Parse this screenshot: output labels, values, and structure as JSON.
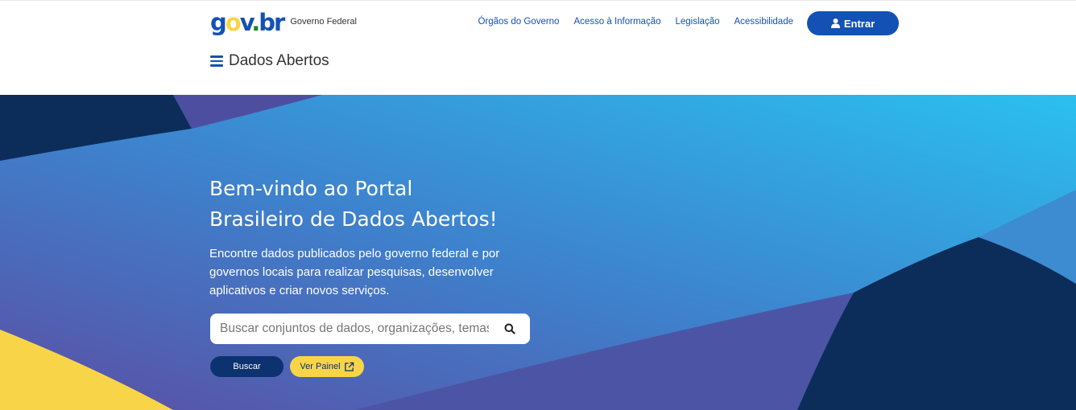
{
  "header": {
    "logo": {
      "g": "g",
      "o": "o",
      "v": "v",
      "dot": ".",
      "br": "br"
    },
    "logo_subtitle": "Governo Federal",
    "nav": [
      {
        "label": "Órgãos do Governo"
      },
      {
        "label": "Acesso à Informação"
      },
      {
        "label": "Legislação"
      },
      {
        "label": "Acessibilidade"
      }
    ],
    "login_label": "Entrar",
    "menu_title": "Dados Abertos"
  },
  "hero": {
    "title_line1": "Bem-vindo ao Portal",
    "title_line2": "Brasileiro de Dados Abertos!",
    "description": "Encontre dados publicados pelo governo federal e por governos locais para realizar pesquisas, desenvolver aplicativos e criar novos serviços.",
    "search_placeholder": "Buscar conjuntos de dados, organizações, temas",
    "search_button": "Buscar",
    "panel_button": "Ver Painel"
  },
  "colors": {
    "primary_blue": "#1351b4",
    "dark_navy": "#0c326f",
    "yellow": "#f8d548",
    "green": "#168821",
    "purple": "#5a4fa3",
    "sky": "#2bbcef"
  },
  "icons": [
    "user-icon",
    "menu-icon",
    "search-icon",
    "external-link-icon"
  ]
}
